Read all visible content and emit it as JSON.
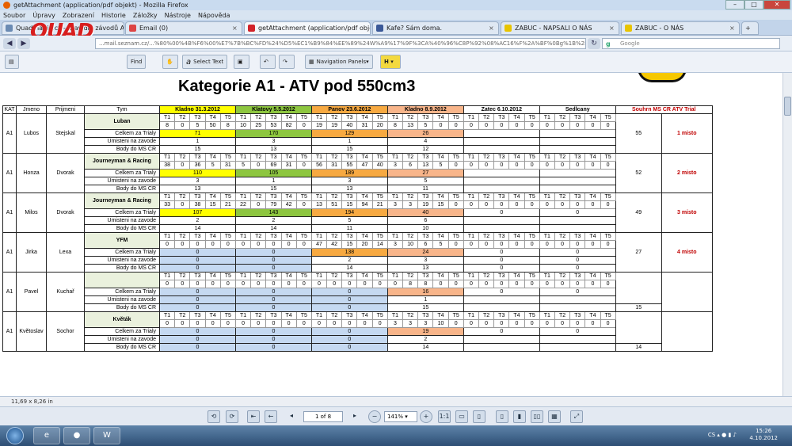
{
  "window": {
    "title": "getAttachment (application/pdf objekt) - Mozilla Firefox"
  },
  "menu": [
    "Soubor",
    "Úpravy",
    "Zobrazení",
    "Historie",
    "Záložky",
    "Nástroje",
    "Nápověda"
  ],
  "tabs": [
    {
      "label": "Quadmania.cz - pravidla závodů ATV, po...",
      "icon_color": "#6b8bb3"
    },
    {
      "label": "Email (0)",
      "icon_color": "#d44"
    },
    {
      "label": "getAttachment (application/pdf obje...",
      "icon_color": "#d2232a",
      "active": true
    },
    {
      "label": "Kafe? Sám doma.",
      "icon_color": "#3b5998"
    },
    {
      "label": "ZABUC - NAPSALI O NÁS",
      "icon_color": "#e8c400"
    },
    {
      "label": "ZABUC - O NÁS",
      "icon_color": "#e8c400"
    }
  ],
  "url": "...mail.seznam.cz/...%80%00%4B%F6%00%E7%7B%BC%FD%24%D5%EC1%B9%84%EE%89%24W%A9%17%9F%3CA%40%96%C8P%92%08%AC16%F%2A%BF%0Bg%1B%2B%AD_%CE9",
  "search_placeholder": "Google",
  "logo_text": [
    "QUAD",
    "MANIA.CZ"
  ],
  "pdf_toolbar": {
    "find": "Find",
    "select_text": "Select Text",
    "navigation_panels": "Navigation Panels"
  },
  "document": {
    "title": "Kategorie A1 - ATV pod 550cm3",
    "headers": {
      "kat": "KAT",
      "jmeno": "Jmeno",
      "prijmeni": "Prijmeni",
      "tym": "Tym",
      "summary": "Souhrn  MS CR ATV Trial"
    },
    "races": [
      "Kladno 31.3.2012",
      "Klatovy 5.5.2012",
      "Panov 23.6.2012",
      "Kladno 8.9.2012",
      "Zatec 6.10.2012",
      "Sedlcany"
    ],
    "t_labels": [
      "T1",
      "T2",
      "T3",
      "T4",
      "T5"
    ],
    "row_labels": [
      "Celkem za Trialy",
      "Umisteni na zavode",
      "Body do MS CR"
    ],
    "riders": [
      {
        "kat": "A1",
        "jmeno": "Lubos",
        "prijmeni": "Stejskal",
        "tym": "Luban",
        "scores": [
          [
            "8",
            "0",
            "5",
            "50",
            "8"
          ],
          [
            "10",
            "25",
            "53",
            "82",
            "0"
          ],
          [
            "19",
            "19",
            "40",
            "31",
            "20"
          ],
          [
            "8",
            "13",
            "5",
            "0",
            "0"
          ],
          [
            "0",
            "0",
            "0",
            "0",
            "0"
          ],
          [
            "0",
            "0",
            "0",
            "0",
            "0"
          ]
        ],
        "celkem": [
          "71",
          "170",
          "129",
          "26",
          "",
          ""
        ],
        "umisteni": [
          "1",
          "3",
          "1",
          "4",
          "",
          ""
        ],
        "body": [
          "15",
          "13",
          "15",
          "12",
          "",
          ""
        ],
        "souhrn": "55",
        "misto": "1 misto"
      },
      {
        "kat": "A1",
        "jmeno": "Honza",
        "prijmeni": "Dvorak",
        "tym": "Journeyman & Racing",
        "scores": [
          [
            "38",
            "0",
            "36",
            "5",
            "31"
          ],
          [
            "5",
            "0",
            "69",
            "31",
            "0"
          ],
          [
            "56",
            "31",
            "55",
            "47",
            "40"
          ],
          [
            "3",
            "6",
            "13",
            "5",
            "0"
          ],
          [
            "0",
            "0",
            "0",
            "0",
            "0"
          ],
          [
            "0",
            "0",
            "0",
            "0",
            "0"
          ]
        ],
        "celkem": [
          "110",
          "105",
          "189",
          "27",
          "",
          ""
        ],
        "umisteni": [
          "3",
          "1",
          "3",
          "5",
          "",
          ""
        ],
        "body": [
          "13",
          "15",
          "13",
          "11",
          "",
          ""
        ],
        "souhrn": "52",
        "misto": "2 misto"
      },
      {
        "kat": "A1",
        "jmeno": "Milos",
        "prijmeni": "Dvorak",
        "tym": "Journeyman & Racing",
        "scores": [
          [
            "33",
            "0",
            "38",
            "15",
            "21"
          ],
          [
            "22",
            "0",
            "79",
            "42",
            "0"
          ],
          [
            "13",
            "51",
            "15",
            "94",
            "21"
          ],
          [
            "3",
            "3",
            "19",
            "15",
            "0"
          ],
          [
            "0",
            "0",
            "0",
            "0",
            "0"
          ],
          [
            "0",
            "0",
            "0",
            "0",
            "0"
          ]
        ],
        "celkem": [
          "107",
          "143",
          "194",
          "40",
          "0",
          "0"
        ],
        "umisteni": [
          "2",
          "2",
          "5",
          "6",
          "",
          ""
        ],
        "body": [
          "14",
          "14",
          "11",
          "10",
          "",
          ""
        ],
        "souhrn": "49",
        "misto": "3 misto"
      },
      {
        "kat": "A1",
        "jmeno": "Jirka",
        "prijmeni": "Lexa",
        "tym": "YFM",
        "scores": [
          [
            "0",
            "0",
            "0",
            "0",
            "0"
          ],
          [
            "0",
            "0",
            "0",
            "0",
            "0"
          ],
          [
            "47",
            "42",
            "15",
            "20",
            "14"
          ],
          [
            "3",
            "10",
            "6",
            "5",
            "0"
          ],
          [
            "0",
            "0",
            "0",
            "0",
            "0"
          ],
          [
            "0",
            "0",
            "0",
            "0",
            "0"
          ]
        ],
        "celkem": [
          "0",
          "0",
          "138",
          "24",
          "0",
          "0"
        ],
        "umisteni": [
          "0",
          "0",
          "2",
          "3",
          "0",
          "0"
        ],
        "body": [
          "0",
          "0",
          "14",
          "13",
          "0",
          "0"
        ],
        "souhrn": "27",
        "misto": "4 misto"
      },
      {
        "kat": "A1",
        "jmeno": "Pavel",
        "prijmeni": "Kuchař",
        "tym": "",
        "scores": [
          [
            "0",
            "0",
            "0",
            "0",
            "0"
          ],
          [
            "0",
            "0",
            "0",
            "0",
            "0"
          ],
          [
            "0",
            "0",
            "0",
            "0",
            "0"
          ],
          [
            "0",
            "8",
            "8",
            "0",
            "0"
          ],
          [
            "0",
            "0",
            "0",
            "0",
            "0"
          ],
          [
            "0",
            "0",
            "0",
            "0",
            "0"
          ]
        ],
        "celkem": [
          "0",
          "0",
          "0",
          "16",
          "0",
          "0"
        ],
        "umisteni": [
          "0",
          "0",
          "0",
          "1",
          "",
          ""
        ],
        "body": [
          "0",
          "0",
          "0",
          "15",
          "",
          ""
        ],
        "souhrn": "",
        "misto": "",
        "souhrn_body": "15"
      },
      {
        "kat": "A1",
        "jmeno": "Květoslav",
        "prijmeni": "Sochor",
        "tym": "Květák",
        "scores": [
          [
            "0",
            "0",
            "0",
            "0",
            "0"
          ],
          [
            "0",
            "0",
            "0",
            "0",
            "0"
          ],
          [
            "0",
            "0",
            "0",
            "0",
            "0"
          ],
          [
            "3",
            "3",
            "3",
            "10",
            "0"
          ],
          [
            "0",
            "0",
            "0",
            "0",
            "0"
          ],
          [
            "0",
            "0",
            "0",
            "0",
            "0"
          ]
        ],
        "celkem": [
          "0",
          "0",
          "0",
          "19",
          "0",
          "0"
        ],
        "umisteni": [
          "0",
          "0",
          "0",
          "2",
          "",
          ""
        ],
        "body": [
          "0",
          "0",
          "0",
          "14",
          "",
          ""
        ],
        "souhrn": "",
        "misto": "",
        "souhrn_body": "14"
      }
    ]
  },
  "status": {
    "page_size": "11,69 x 8,26 in"
  },
  "bottom": {
    "page": "1 of 8",
    "zoom": "141%"
  },
  "taskbar": {
    "lang": "CS",
    "time": "15:26",
    "date": "4.10.2012"
  }
}
